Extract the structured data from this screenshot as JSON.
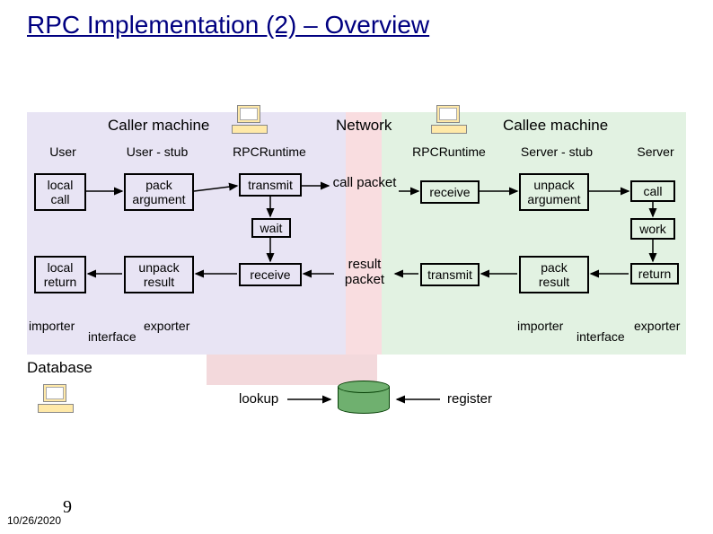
{
  "title": "RPC Implementation (2) – Overview",
  "headers": {
    "caller": "Caller machine",
    "network": "Network",
    "callee": "Callee machine"
  },
  "cols": {
    "user": "User",
    "user_stub": "User - stub",
    "rpcruntime_l": "RPCRuntime",
    "rpcruntime_r": "RPCRuntime",
    "server_stub": "Server - stub",
    "server": "Server"
  },
  "boxes": {
    "local_call": "local\ncall",
    "pack_arg": "pack\nargument",
    "transmit": "transmit",
    "wait": "wait",
    "local_return": "local\nreturn",
    "unpack_result": "unpack\nresult",
    "receive_l": "receive",
    "receive_r": "receive",
    "unpack_arg": "unpack\nargument",
    "call": "call",
    "work": "work",
    "transmit_r": "transmit",
    "pack_result": "pack\nresult",
    "return": "return"
  },
  "net_labels": {
    "call_packet": "call packet",
    "result_packet": "result\npacket"
  },
  "interface": {
    "importer": "importer",
    "exporter": "exporter",
    "word": "interface"
  },
  "database": {
    "label": "Database",
    "lookup": "lookup",
    "register": "register"
  },
  "footer": {
    "date": "10/26/2020",
    "page": "9"
  }
}
